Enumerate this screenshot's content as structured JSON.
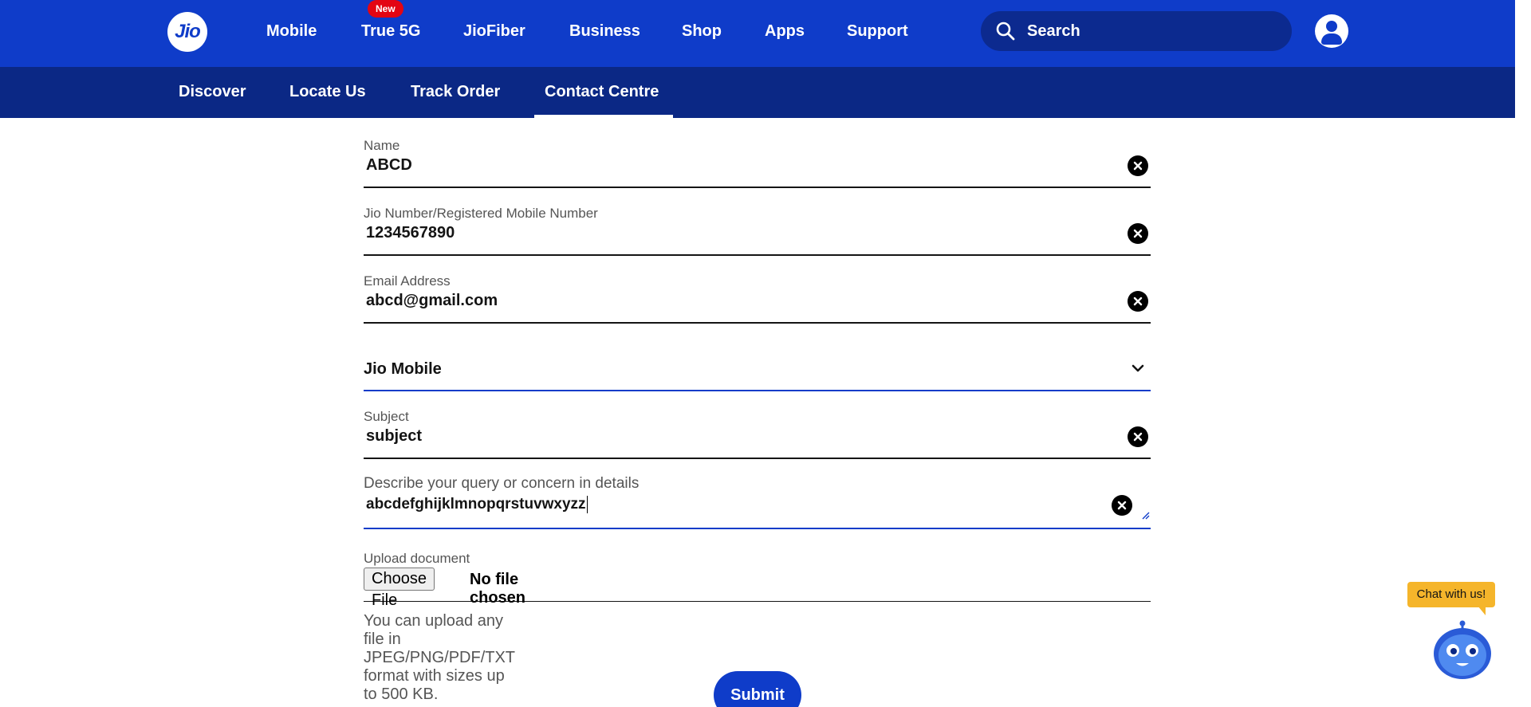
{
  "header": {
    "logo_text": "Jio",
    "nav": [
      {
        "label": "Mobile"
      },
      {
        "label": "True 5G",
        "badge": "New"
      },
      {
        "label": "JioFiber"
      },
      {
        "label": "Business"
      },
      {
        "label": "Shop"
      },
      {
        "label": "Apps"
      },
      {
        "label": "Support"
      }
    ],
    "search_label": "Search"
  },
  "subnav": {
    "items": [
      "Discover",
      "Locate Us",
      "Track Order",
      "Contact Centre"
    ],
    "active": "Contact Centre"
  },
  "form": {
    "name": {
      "label": "Name",
      "value": "ABCD"
    },
    "mobile": {
      "label": "Jio Number/Registered Mobile Number",
      "value": "1234567890"
    },
    "email": {
      "label": "Email Address",
      "value": "abcd@gmail.com"
    },
    "service": {
      "value": "Jio Mobile"
    },
    "subject": {
      "label": "Subject",
      "value": "subject"
    },
    "details": {
      "label": "Describe your query or concern in details",
      "value": "abcdefghijklmnopqrstuvwxyzz"
    },
    "upload": {
      "label": "Upload document",
      "button": "Choose File",
      "status": "No file chosen",
      "hint": "You can upload any file in JPEG/PNG/PDF/TXT format with sizes up to 500 KB."
    },
    "submit_label": "Submit"
  },
  "chat": {
    "label": "Chat with us!"
  },
  "colors": {
    "brand": "#0f3cc9",
    "subnav": "#0b2885",
    "badge": "#e30513",
    "chat_bubble": "#f5b52b"
  }
}
